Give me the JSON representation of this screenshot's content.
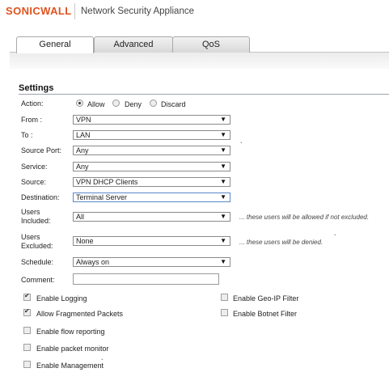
{
  "header": {
    "brand": "SONICWALL",
    "title": "Network Security Appliance"
  },
  "tabs": [
    {
      "label": "General"
    },
    {
      "label": "Advanced"
    },
    {
      "label": "QoS"
    }
  ],
  "settings": {
    "title": "Settings",
    "action": {
      "label": "Action:",
      "options": [
        "Allow",
        "Deny",
        "Discard"
      ],
      "selected": "Allow"
    },
    "from": {
      "label": "From :",
      "value": "VPN"
    },
    "to": {
      "label": "To :",
      "value": "LAN"
    },
    "source_port": {
      "label": "Source Port:",
      "value": "Any"
    },
    "service": {
      "label": "Service:",
      "value": "Any"
    },
    "source": {
      "label": "Source:",
      "value": "VPN DHCP Clients"
    },
    "destination": {
      "label": "Destination:",
      "value": "Terminal Server"
    },
    "users_included": {
      "label_1": "Users",
      "label_2": "Included:",
      "value": "All",
      "hint": "... these users will be allowed if not excluded."
    },
    "users_excluded": {
      "label_1": "Users",
      "label_2": "Excluded:",
      "value": "None",
      "hint": "... these users will be denied."
    },
    "schedule": {
      "label": "Schedule:",
      "value": "Always on"
    },
    "comment": {
      "label": "Comment:",
      "value": ""
    },
    "options": {
      "enable_logging": {
        "label": "Enable Logging",
        "checked": true
      },
      "allow_fragmented": {
        "label": "Allow Fragmented Packets",
        "checked": true
      },
      "flow_reporting": {
        "label": "Enable flow reporting",
        "checked": false
      },
      "packet_monitor": {
        "label": "Enable packet monitor",
        "checked": false
      },
      "management": {
        "label": "Enable Management",
        "checked": false
      },
      "geo_ip": {
        "label": "Enable Geo-IP Filter",
        "checked": false
      },
      "botnet": {
        "label": "Enable Botnet Filter",
        "checked": false
      }
    }
  },
  "colors": {
    "brand": "#e0521d",
    "tab_border": "#a9a9a9",
    "focus_border": "#5a89c9"
  }
}
